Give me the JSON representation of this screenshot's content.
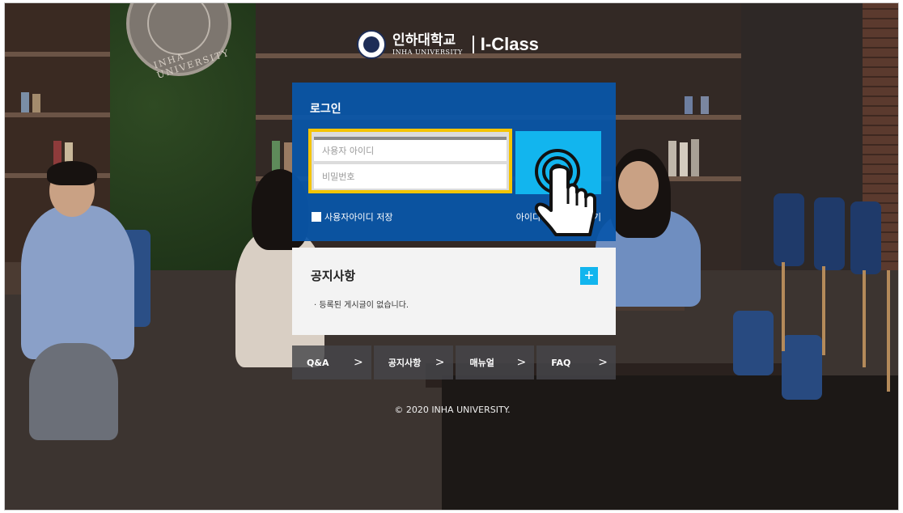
{
  "brand": {
    "korean_name": "인하대학교",
    "english_name": "INHA UNIVERSITY",
    "product": "I-Class"
  },
  "background_seal": {
    "text": "INHA UNIVERSITY"
  },
  "login": {
    "title": "로그인",
    "id_placeholder": "사용자 아이디",
    "password_placeholder": "비밀번호",
    "remember_label": "사용자아이디 저장",
    "find_link": "아이디 / 비밀번호 찾기"
  },
  "notice": {
    "title": "공지사항",
    "plus": "+",
    "empty_message": "· 등록된 게시글이 없습니다."
  },
  "quick_links": [
    {
      "label": "Q&A",
      "chevron": ">"
    },
    {
      "label": "공지사항",
      "chevron": ">"
    },
    {
      "label": "매뉴얼",
      "chevron": ">"
    },
    {
      "label": "FAQ",
      "chevron": ">"
    }
  ],
  "footer": {
    "copyright": "© 2020 INHA UNIVERSITY."
  },
  "colors": {
    "login_panel": "#0956aa",
    "accent_blue": "#12b5ee",
    "highlight_yellow": "#f5c400"
  },
  "icons": {
    "pointer": "hand-tap-icon",
    "emblem": "inha-emblem-icon"
  }
}
